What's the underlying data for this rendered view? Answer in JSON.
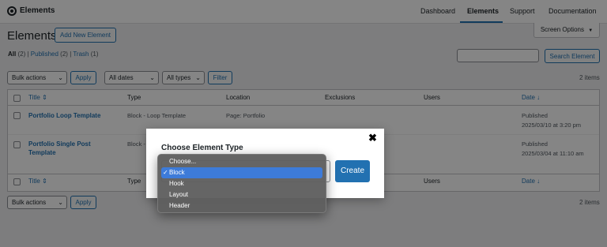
{
  "topbar": {
    "app_title": "Elements",
    "nav": [
      "Dashboard",
      "Elements",
      "Support",
      "Documentation"
    ],
    "active_nav": "Elements"
  },
  "header": {
    "page_title": "Elements",
    "add_new_label": "Add New Element",
    "screen_options_label": "Screen Options",
    "screen_options_icon": "▼"
  },
  "views": {
    "all_label": "All",
    "all_count": "(2)",
    "published_label": "Published",
    "published_count": "(2)",
    "trash_label": "Trash",
    "trash_count": "(1)",
    "sep": "|"
  },
  "search": {
    "value": "",
    "button_label": "Search Element"
  },
  "filters": {
    "bulk_actions": "Bulk actions",
    "apply_label": "Apply",
    "dates": "All dates",
    "types": "All types",
    "filter_label": "Filter",
    "items_count": "2 items"
  },
  "table": {
    "columns": {
      "title": "Title",
      "type": "Type",
      "location": "Location",
      "exclusions": "Exclusions",
      "users": "Users",
      "date": "Date"
    },
    "rows": [
      {
        "title": "Portfolio Loop Template",
        "type": "Block - Loop Template",
        "location": "Page: Portfolio",
        "exclusions": "",
        "users": "",
        "date_status": "Published",
        "date": "2025/03/10 at 3:20 pm"
      },
      {
        "title_line1": "Portfolio Single Post",
        "title_line2": "Template",
        "type": "Block -",
        "location": "",
        "exclusions": "",
        "users": "",
        "date_status": "Published",
        "date": "2025/03/04 at 11:10 am"
      }
    ]
  },
  "bottom": {
    "bulk_actions": "Bulk actions",
    "apply_label": "Apply",
    "items_count": "2 items"
  },
  "modal": {
    "title": "Choose Element Type",
    "close_icon": "✖",
    "create_label": "Create",
    "selected": "Block",
    "options": [
      "Choose...",
      "Block",
      "Hook",
      "Layout",
      "Header"
    ],
    "check_icon": "✓"
  },
  "colors": {
    "accent": "#2271b1",
    "highlight": "#3d7bd9",
    "overlay": "rgba(0,0,0,0.48)"
  }
}
